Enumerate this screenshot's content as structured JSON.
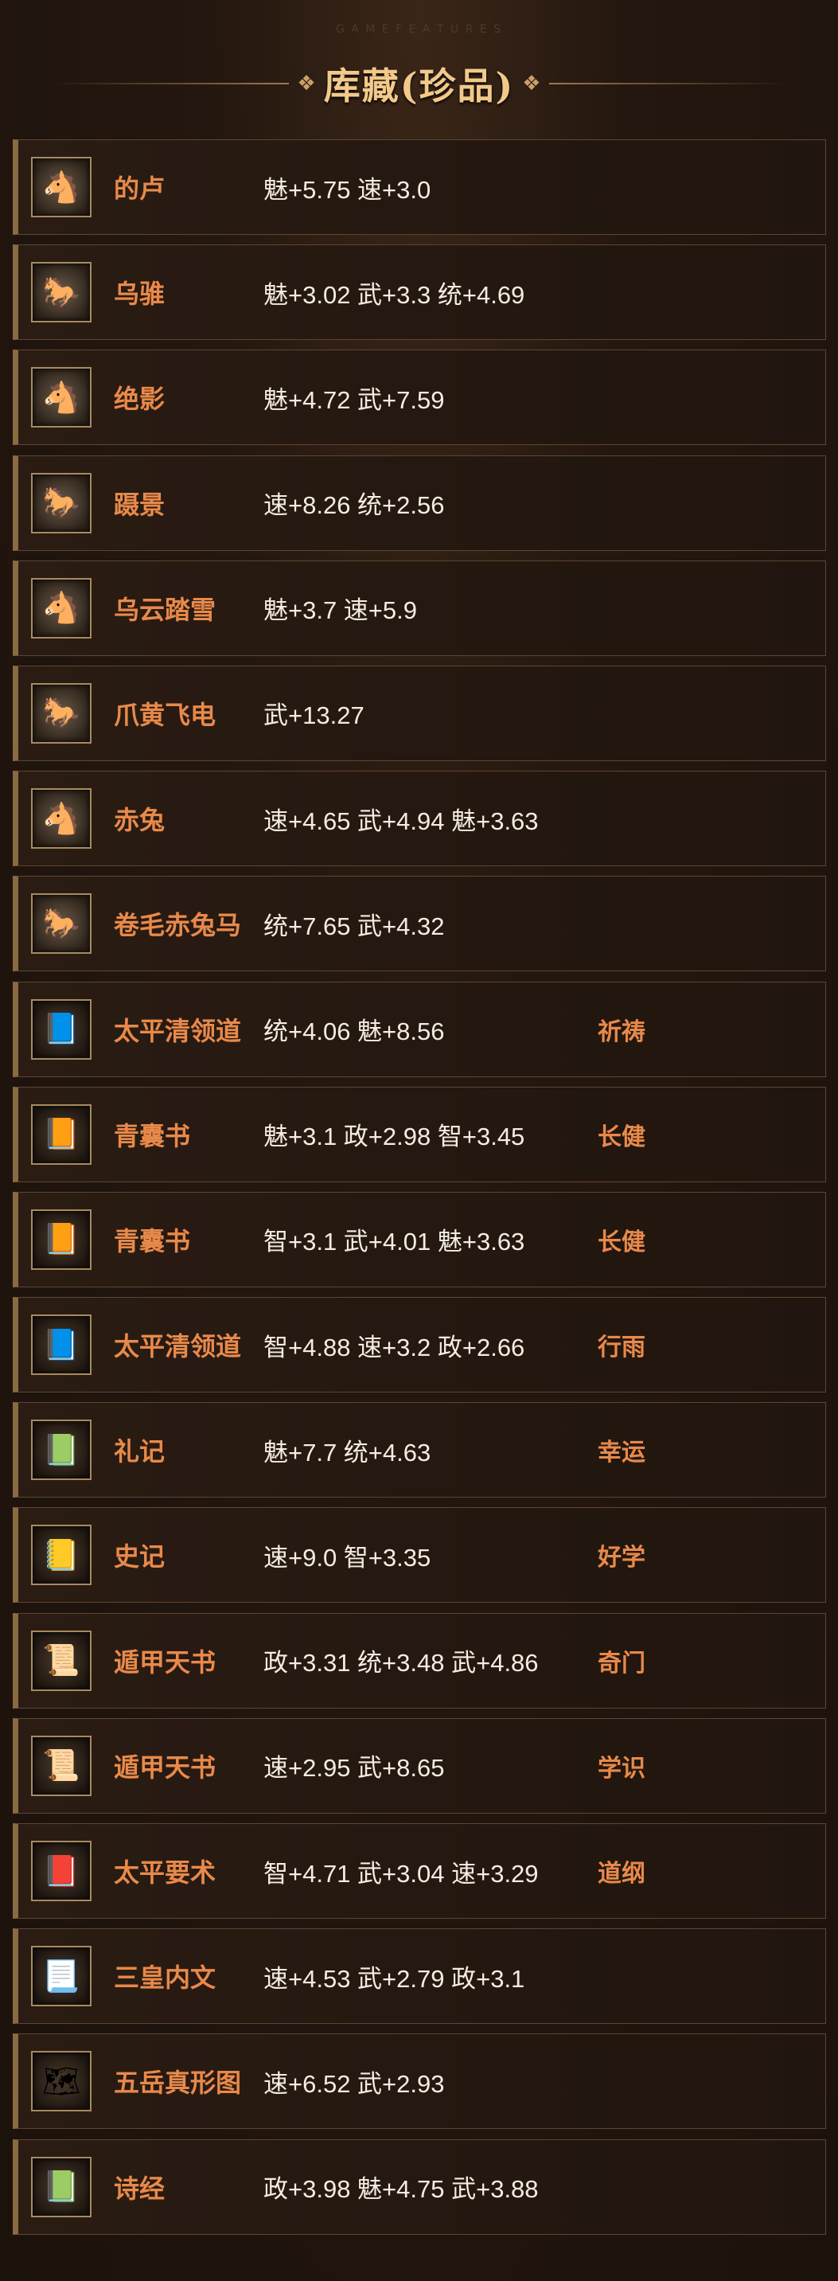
{
  "header": {
    "watermark": "G A M E   F E A T U R E S",
    "title": "库藏(珍品)"
  },
  "items": [
    {
      "name": "的卢",
      "stats": "魅+5.75 速+3.0",
      "skill": "",
      "icon": "horse-icon",
      "glyph": "🐴"
    },
    {
      "name": "乌骓",
      "stats": "魅+3.02 武+3.3 统+4.69",
      "skill": "",
      "icon": "horse-icon",
      "glyph": "🐎"
    },
    {
      "name": "绝影",
      "stats": "魅+4.72 武+7.59",
      "skill": "",
      "icon": "horse-icon",
      "glyph": "🐴"
    },
    {
      "name": "蹑景",
      "stats": "速+8.26 统+2.56",
      "skill": "",
      "icon": "horse-icon",
      "glyph": "🐎"
    },
    {
      "name": "乌云踏雪",
      "stats": "魅+3.7 速+5.9",
      "skill": "",
      "icon": "horse-icon",
      "glyph": "🐴"
    },
    {
      "name": "爪黄飞电",
      "stats": "武+13.27",
      "skill": "",
      "icon": "horse-icon",
      "glyph": "🐎"
    },
    {
      "name": "赤兔",
      "stats": "速+4.65 武+4.94 魅+3.63",
      "skill": "",
      "icon": "horse-icon",
      "glyph": "🐴"
    },
    {
      "name": "卷毛赤兔马",
      "stats": "统+7.65 武+4.32",
      "skill": "",
      "icon": "horse-icon",
      "glyph": "🐎"
    },
    {
      "name": "太平清领道",
      "stats": "统+4.06 魅+8.56",
      "skill": "祈祷",
      "icon": "book-icon",
      "glyph": "📘"
    },
    {
      "name": "青囊书",
      "stats": "魅+3.1 政+2.98 智+3.45",
      "skill": "长健",
      "icon": "book-icon",
      "glyph": "📙"
    },
    {
      "name": "青囊书",
      "stats": "智+3.1 武+4.01 魅+3.63",
      "skill": "长健",
      "icon": "book-icon",
      "glyph": "📙"
    },
    {
      "name": "太平清领道",
      "stats": "智+4.88 速+3.2 政+2.66",
      "skill": "行雨",
      "icon": "book-icon",
      "glyph": "📘"
    },
    {
      "name": "礼记",
      "stats": "魅+7.7 统+4.63",
      "skill": "幸运",
      "icon": "book-icon",
      "glyph": "📗"
    },
    {
      "name": "史记",
      "stats": "速+9.0 智+3.35",
      "skill": "好学",
      "icon": "book-icon",
      "glyph": "📒"
    },
    {
      "name": "遁甲天书",
      "stats": "政+3.31 统+3.48 武+4.86",
      "skill": "奇门",
      "icon": "book-icon",
      "glyph": "📜"
    },
    {
      "name": "遁甲天书",
      "stats": "速+2.95 武+8.65",
      "skill": "学识",
      "icon": "book-icon",
      "glyph": "📜"
    },
    {
      "name": "太平要术",
      "stats": "智+4.71 武+3.04 速+3.29",
      "skill": "道纲",
      "icon": "book-icon",
      "glyph": "📕"
    },
    {
      "name": "三皇内文",
      "stats": "速+4.53 武+2.79 政+3.1",
      "skill": "",
      "icon": "scroll-icon",
      "glyph": "📃"
    },
    {
      "name": "五岳真形图",
      "stats": "速+6.52 武+2.93",
      "skill": "",
      "icon": "scroll-icon",
      "glyph": "🗺"
    },
    {
      "name": "诗经",
      "stats": "政+3.98 魅+4.75 武+3.88",
      "skill": "",
      "icon": "book-icon",
      "glyph": "📗"
    }
  ]
}
